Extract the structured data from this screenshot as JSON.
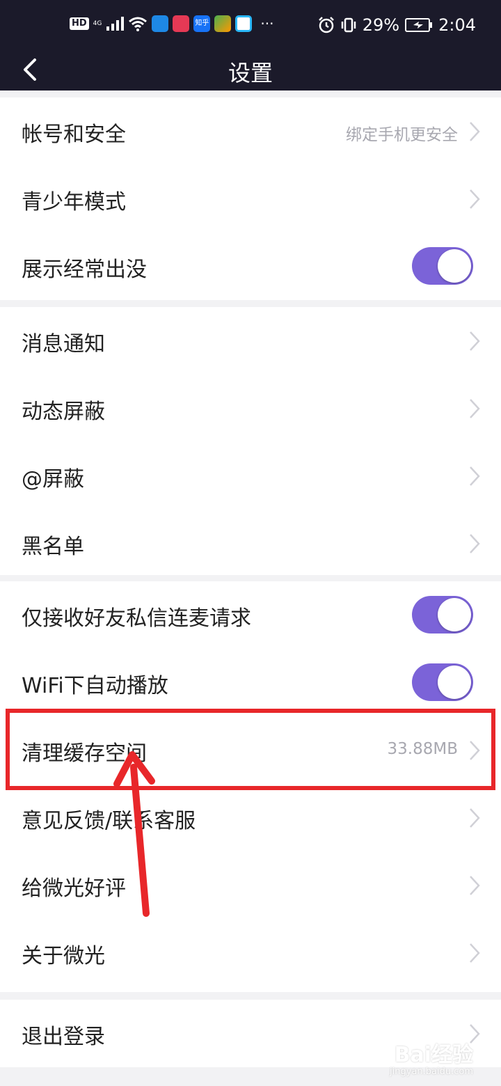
{
  "status_bar": {
    "hd": "HD",
    "network": "4G",
    "app_zhihu": "知乎",
    "more": "···",
    "battery": "29%",
    "time": "2:04"
  },
  "nav": {
    "title": "设置"
  },
  "groups": {
    "account": {
      "account_security": {
        "label": "帐号和安全",
        "hint": "绑定手机更安全"
      },
      "teen_mode": {
        "label": "青少年模式"
      },
      "show_frequent": {
        "label": "展示经常出没",
        "enabled": true
      }
    },
    "notify": {
      "message_notify": {
        "label": "消息通知"
      },
      "feed_block": {
        "label": "动态屏蔽"
      },
      "at_block": {
        "label": "@屏蔽"
      },
      "blacklist": {
        "label": "黑名单"
      }
    },
    "misc": {
      "friends_only": {
        "label": "仅接收好友私信连麦请求",
        "enabled": true
      },
      "wifi_autoplay": {
        "label": "WiFi下自动播放",
        "enabled": true
      },
      "clear_cache": {
        "label": "清理缓存空间",
        "hint": "33.88MB"
      },
      "feedback": {
        "label": "意见反馈/联系客服"
      },
      "rate_app": {
        "label": "给微光好评"
      },
      "about": {
        "label": "关于微光"
      }
    },
    "logout": {
      "logout": {
        "label": "退出登录"
      }
    }
  },
  "watermark": {
    "brand": "Bai经验",
    "url": "jingyan.baidu.com"
  },
  "colors": {
    "accent": "#7b63d8",
    "annotation": "#e8272a",
    "header_bg": "#1b1a2a"
  }
}
